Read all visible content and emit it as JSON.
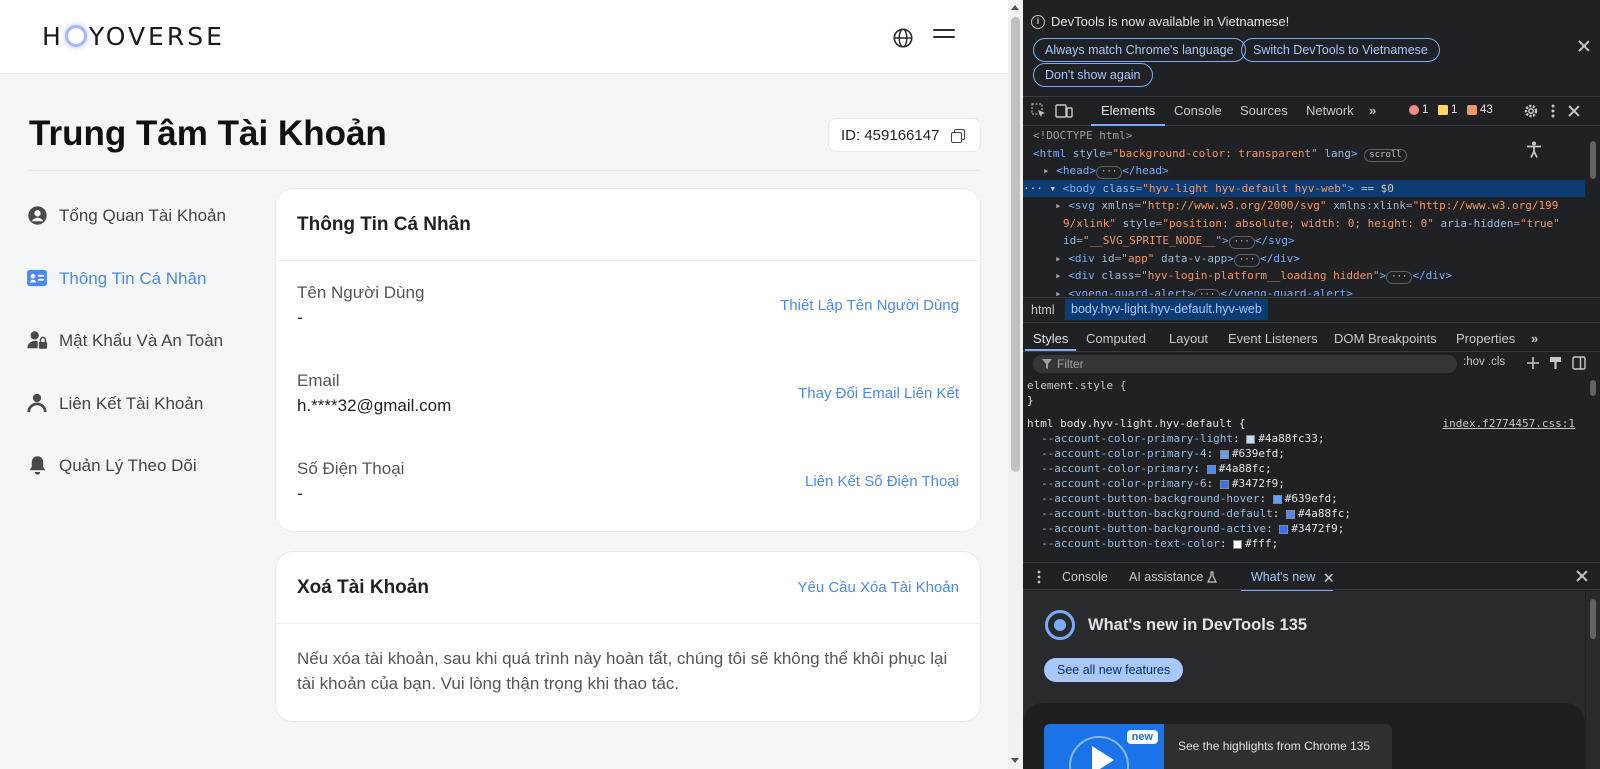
{
  "brand": {
    "logo_left": "H",
    "logo_right": "YOVERSE"
  },
  "header": {
    "title": "Trung Tâm Tài Khoản",
    "account_id": "ID: 459166147"
  },
  "sidebar": {
    "items": [
      {
        "label": "Tổng Quan Tài Khoản",
        "icon": "user-circle-icon"
      },
      {
        "label": "Thông Tin Cá Nhân",
        "icon": "id-card-icon",
        "active": true
      },
      {
        "label": "Mật Khẩu Và An Toàn",
        "icon": "user-lock-icon"
      },
      {
        "label": "Liên Kết Tài Khoản",
        "icon": "user-link-icon"
      },
      {
        "label": "Quản Lý Theo Dõi",
        "icon": "bell-icon"
      }
    ]
  },
  "personal": {
    "title": "Thông Tin Cá Nhân",
    "username": {
      "label": "Tên Người Dùng",
      "value": "-",
      "action": "Thiết Lập Tên Người Dùng"
    },
    "email": {
      "label": "Email",
      "value": "h.****32@gmail.com",
      "action": "Thay Đổi Email Liên Kết"
    },
    "phone": {
      "label": "Số Điện Thoại",
      "value": "-",
      "action": "Liên Kết Số Điện Thoại"
    }
  },
  "delete": {
    "title": "Xoá Tài Khoản",
    "action": "Yêu Cầu Xóa Tài Khoản",
    "description": "Nếu xóa tài khoản, sau khi quá trình này hoàn tất, chúng tôi sẽ không thể khôi phục lại tài khoản của bạn. Vui lòng thận trọng khi thao tác."
  },
  "devtools": {
    "banner": {
      "message": "DevTools is now available in Vietnamese!",
      "btn_match": "Always match Chrome's language",
      "btn_switch": "Switch DevTools to Vietnamese",
      "btn_dont": "Don't show again"
    },
    "tabs": [
      "Elements",
      "Console",
      "Sources",
      "Network"
    ],
    "more_tabs": "»",
    "counts": {
      "errors": "1",
      "warnings": "1",
      "issues": "43"
    },
    "dom": {
      "doctype": "<!DOCTYPE html>",
      "html_open": "<html",
      "html_attr": "style",
      "html_val": "\"background-color: transparent\"",
      "html_lang": "lang",
      "html_close": ">",
      "scroll": "scroll",
      "head_open": "<head>",
      "head_close": "</head>",
      "body_open": "<body",
      "body_attr": "class",
      "body_val": "\"hyv-light hyv-default hyv-web\"",
      "body_close": ">",
      "body_eq": "== $0",
      "svg_open": "<svg",
      "svg_attr1": "xmlns",
      "svg_val1": "\"http://www.w3.org/2000/svg\"",
      "svg_attr2": "xmlns:xlink",
      "svg_val2a": "\"http://www.w3.org/199",
      "svg_val2b": "9/xlink\"",
      "svg_attr3": "style",
      "svg_val3": "\"position: absolute; width: 0; height: 0\"",
      "svg_attr4": "aria-hidden",
      "svg_val4": "\"true\"",
      "svg_attr5": "id",
      "svg_val5": "\"__SVG_SPRITE_NODE__\"",
      "svg_end": "</svg>",
      "app_open": "<div",
      "app_attr1": "id",
      "app_val1": "\"app\"",
      "app_attr2": "data-v-app",
      "app_close": "</div>",
      "login_open": "<div",
      "login_attr": "class",
      "login_val": "\"hyv-login-platform__loading hidden\"",
      "login_close": "</div>",
      "last_partial": "<yoeng-guard-alert>",
      "last_partial_close": "</yoeng-guard-alert>",
      "ellipsis": "···",
      "tag_gt": ">"
    },
    "breadcrumbs": [
      "html",
      "body.hyv-light.hyv-default.hyv-web"
    ],
    "subtabs": [
      "Styles",
      "Computed",
      "Layout",
      "Event Listeners",
      "DOM Breakpoints",
      "Properties"
    ],
    "filter_placeholder": "Filter",
    "filter_tools": ":hov  .cls",
    "styles": {
      "element_style": "element.style {",
      "close_brace": "}",
      "rule_selector": "html body.hyv-light.hyv-default {",
      "source": "index.f2774457.css:1",
      "props": [
        {
          "name": "--account-color-primary-light",
          "value": "#4a88fc33",
          "color": "#c9dafd"
        },
        {
          "name": "--account-color-primary-4",
          "value": "#639efd",
          "color": "#639efd"
        },
        {
          "name": "--account-color-primary",
          "value": "#4a88fc",
          "color": "#4a88fc"
        },
        {
          "name": "--account-color-primary-6",
          "value": "#3472f9",
          "color": "#3472f9"
        },
        {
          "name": "--account-button-background-hover",
          "value": "#639efd",
          "color": "#639efd"
        },
        {
          "name": "--account-button-background-default",
          "value": "#4a88fc",
          "color": "#4a88fc"
        },
        {
          "name": "--account-button-background-active",
          "value": "#3472f9",
          "color": "#3472f9"
        },
        {
          "name": "--account-button-text-color",
          "value": "#fff",
          "color": "#ffffff"
        }
      ]
    },
    "drawer_tabs": [
      "Console",
      "AI assistance",
      "What's new"
    ],
    "whats_new": {
      "title": "What's new in DevTools 135",
      "button": "See all new features",
      "new_tag": "new",
      "highlight": "See the highlights from Chrome 135"
    }
  }
}
